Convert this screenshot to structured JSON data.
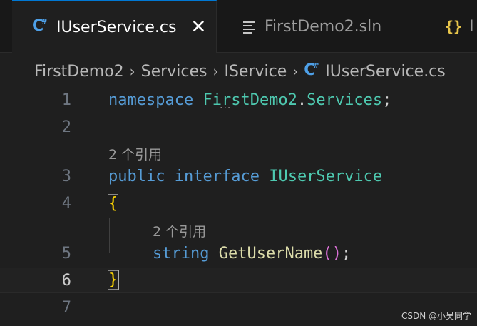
{
  "tabs": [
    {
      "label": "IUserService.cs",
      "icon": "csharp-icon",
      "active": true
    },
    {
      "label": "FirstDemo2.sln",
      "icon": "solution-icon",
      "active": false
    },
    {
      "label": "I",
      "icon": "json-icon",
      "active": false
    }
  ],
  "breadcrumb": [
    "FirstDemo2",
    "Services",
    "IService",
    "IUserService.cs"
  ],
  "editor": {
    "line_numbers": [
      "1",
      "2",
      "3",
      "4",
      "5",
      "6",
      "7"
    ],
    "lens_text": "2 个引用",
    "tokens": {
      "namespace_kw": "namespace",
      "namespace_name": "FirstDemo2",
      "namespace_dot": ".",
      "namespace_services": "Services",
      "semicolon": ";",
      "public_kw": "public",
      "interface_kw": "interface",
      "interface_name": "IUserService",
      "open_brace": "{",
      "string_kw": "string",
      "method_name": "GetUserName",
      "open_paren": "(",
      "close_paren": ")",
      "method_semicolon": ";",
      "close_brace": "}"
    },
    "current_line": "6"
  },
  "watermark": "CSDN @小吴同学",
  "colors": {
    "accent": "#0078d4",
    "keyword": "#569cd6",
    "type": "#4ec9b0",
    "function": "#dcdcaa",
    "brace": "#ffd700",
    "paren": "#da70d6"
  }
}
